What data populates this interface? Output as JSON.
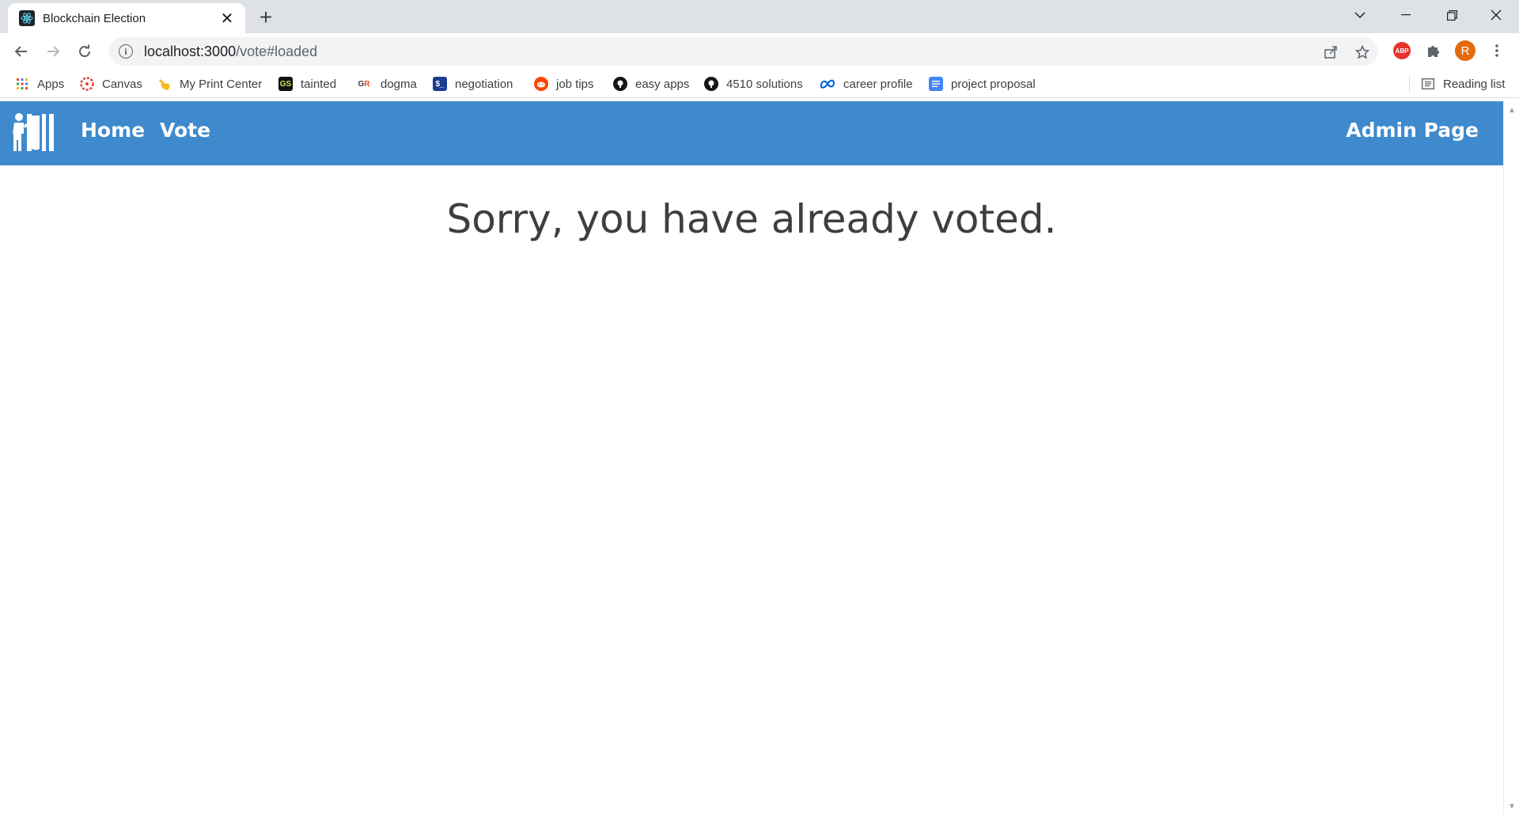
{
  "browser": {
    "tab": {
      "title": "Blockchain Election",
      "favicon": "react-icon"
    },
    "address": {
      "host": "localhost:3000",
      "path": "/vote#loaded"
    },
    "profile_initial": "R",
    "extension_abp_label": "ABP",
    "bookmarks": [
      {
        "label": "Apps",
        "icon": "apps-grid-icon"
      },
      {
        "label": "Canvas",
        "icon": "canvas-icon"
      },
      {
        "label": "My Print Center",
        "icon": "hand-pointer-icon"
      },
      {
        "label": "tainted",
        "icon": "gs-icon"
      },
      {
        "label": "dogma",
        "icon": "goodreads-icon"
      },
      {
        "label": "negotiation",
        "icon": "terminal-icon"
      },
      {
        "label": "job tips",
        "icon": "reddit-icon"
      },
      {
        "label": "easy apps",
        "icon": "github-icon"
      },
      {
        "label": "4510 solutions",
        "icon": "github-icon"
      },
      {
        "label": "career profile",
        "icon": "meta-icon"
      },
      {
        "label": "project proposal",
        "icon": "docs-icon"
      }
    ],
    "reading_list_label": "Reading list"
  },
  "page": {
    "nav": {
      "home": "Home",
      "vote": "Vote",
      "admin": "Admin Page"
    },
    "message": "Sorry, you have already voted."
  },
  "colors": {
    "navbar": "#3e8acd",
    "message_text": "#3c3f42"
  }
}
